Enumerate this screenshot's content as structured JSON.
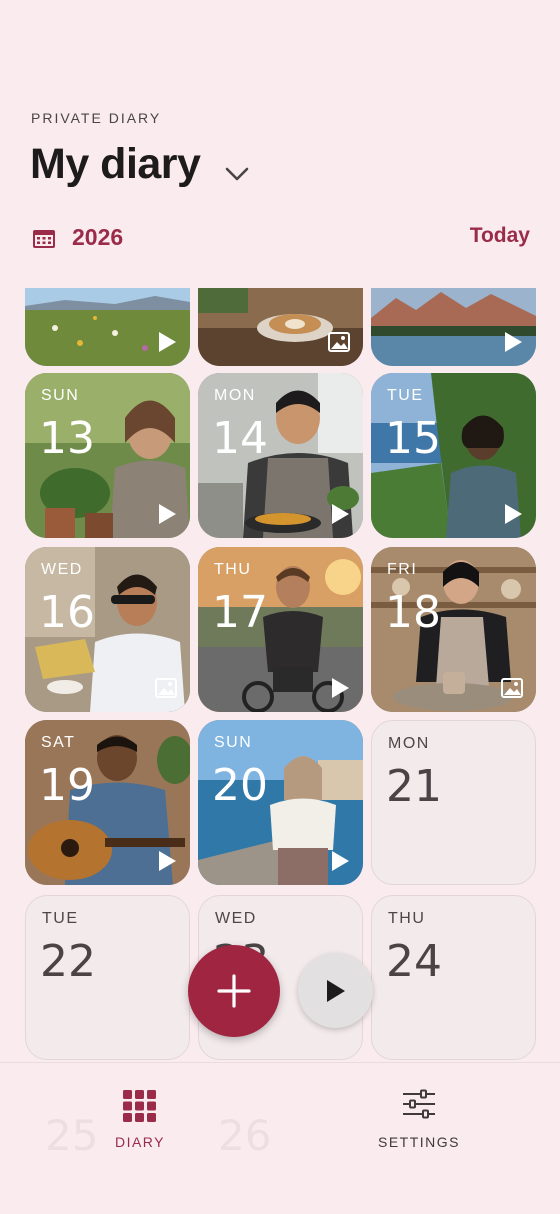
{
  "header": {
    "eyebrow": "PRIVATE DIARY",
    "title": "My diary",
    "year": "2026",
    "today_label": "Today"
  },
  "colors": {
    "accent": "#9a2c4a",
    "fab": "#a02541",
    "background": "#f9ebee",
    "empty_tile": "#f3eaeb"
  },
  "top_strip": [
    {
      "badge": "play-icon"
    },
    {
      "badge": "image-icon"
    },
    {
      "badge": "play-icon"
    }
  ],
  "days": [
    {
      "dow": "SUN",
      "num": "13",
      "kind": "photo",
      "badge": "play-icon"
    },
    {
      "dow": "MON",
      "num": "14",
      "kind": "photo",
      "badge": "play-icon"
    },
    {
      "dow": "TUE",
      "num": "15",
      "kind": "photo",
      "badge": "play-icon"
    },
    {
      "dow": "WED",
      "num": "16",
      "kind": "photo",
      "badge": "image-icon"
    },
    {
      "dow": "THU",
      "num": "17",
      "kind": "photo",
      "badge": "play-icon"
    },
    {
      "dow": "FRI",
      "num": "18",
      "kind": "photo",
      "badge": "image-icon"
    },
    {
      "dow": "SAT",
      "num": "19",
      "kind": "photo",
      "badge": "play-icon"
    },
    {
      "dow": "SUN",
      "num": "20",
      "kind": "photo",
      "badge": "play-icon"
    },
    {
      "dow": "MON",
      "num": "21",
      "kind": "empty"
    },
    {
      "dow": "TUE",
      "num": "22",
      "kind": "empty"
    },
    {
      "dow": "WED",
      "num": "23",
      "kind": "empty"
    },
    {
      "dow": "THU",
      "num": "24",
      "kind": "empty"
    }
  ],
  "nav": {
    "diary_label": "DIARY",
    "settings_label": "SETTINGS"
  },
  "ghost_numbers": [
    "25",
    "26"
  ]
}
